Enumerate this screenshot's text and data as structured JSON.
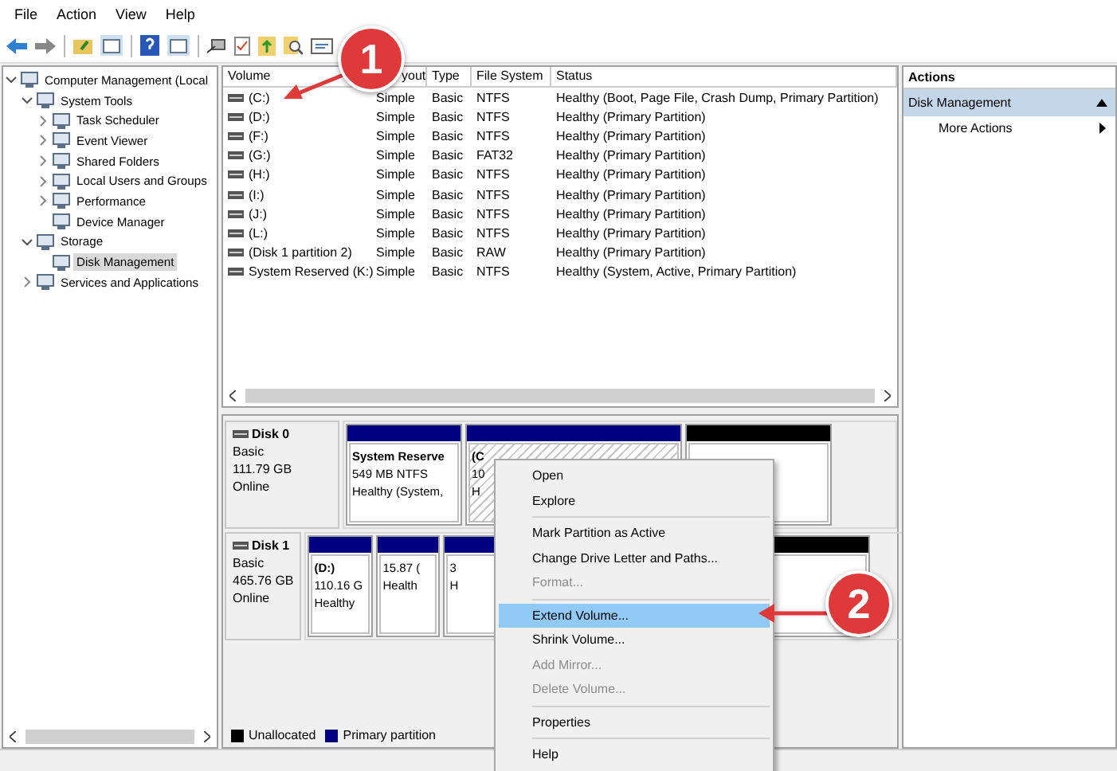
{
  "menu": [
    "File",
    "Action",
    "View",
    "Help"
  ],
  "tree": [
    {
      "label": "Computer Management (Local",
      "expanded": true,
      "selected": false,
      "children": [
        {
          "label": "System Tools",
          "expanded": true,
          "selected": false,
          "children": [
            {
              "label": "Task Scheduler",
              "expanded": false,
              "selected": false
            },
            {
              "label": "Event Viewer",
              "expanded": false,
              "selected": false
            },
            {
              "label": "Shared Folders",
              "expanded": false,
              "selected": false
            },
            {
              "label": "Local Users and Groups",
              "expanded": false,
              "selected": false
            },
            {
              "label": "Performance",
              "expanded": false,
              "selected": false
            },
            {
              "label": "Device Manager",
              "selected": false
            }
          ]
        },
        {
          "label": "Storage",
          "expanded": true,
          "selected": false,
          "children": [
            {
              "label": "Disk Management",
              "selected": true
            }
          ]
        },
        {
          "label": "Services and Applications",
          "expanded": false,
          "selected": false
        }
      ]
    }
  ],
  "volumes": {
    "columns": [
      "Volume",
      "yout",
      "Type",
      "File System",
      "Status"
    ],
    "rows": [
      [
        "(C:)",
        "Simple",
        "Basic",
        "NTFS",
        "Healthy (Boot, Page File, Crash Dump, Primary Partition)"
      ],
      [
        "(D:)",
        "Simple",
        "Basic",
        "NTFS",
        "Healthy (Primary Partition)"
      ],
      [
        "(F:)",
        "Simple",
        "Basic",
        "NTFS",
        "Healthy (Primary Partition)"
      ],
      [
        "(G:)",
        "Simple",
        "Basic",
        "FAT32",
        "Healthy (Primary Partition)"
      ],
      [
        "(H:)",
        "Simple",
        "Basic",
        "NTFS",
        "Healthy (Primary Partition)"
      ],
      [
        "(I:)",
        "Simple",
        "Basic",
        "NTFS",
        "Healthy (Primary Partition)"
      ],
      [
        "(J:)",
        "Simple",
        "Basic",
        "NTFS",
        "Healthy (Primary Partition)"
      ],
      [
        "(L:)",
        "Simple",
        "Basic",
        "NTFS",
        "Healthy (Primary Partition)"
      ],
      [
        "(Disk 1 partition 2)",
        "Simple",
        "Basic",
        "RAW",
        "Healthy (Primary Partition)"
      ],
      [
        "System Reserved (K:)",
        "Simple",
        "Basic",
        "NTFS",
        "Healthy (System, Active, Primary Partition)"
      ]
    ]
  },
  "disks": [
    {
      "name": "Disk 0",
      "lines": [
        "Basic",
        "111.79 GB",
        "Online"
      ],
      "partitions": [
        {
          "kind": "primary",
          "selected": false,
          "title": "System Reserve",
          "lines": [
            "549 MB NTFS",
            "Healthy (System,"
          ]
        },
        {
          "kind": "primary",
          "selected": true,
          "title": "(C",
          "lines": [
            "10",
            "H"
          ]
        },
        {
          "kind": "unallocated",
          "selected": false
        }
      ]
    },
    {
      "name": "Disk 1",
      "lines": [
        "Basic",
        "465.76 GB",
        "Online"
      ],
      "partitions": [
        {
          "kind": "primary",
          "selected": false,
          "title": "(D:)",
          "lines": [
            "110.16 G",
            "Healthy"
          ]
        },
        {
          "kind": "primary",
          "selected": false,
          "lines": [
            "15.87 (",
            "Health"
          ]
        },
        {
          "kind": "primary",
          "selected": false,
          "lines": [
            "3",
            "H"
          ]
        },
        {
          "kind": "unallocated",
          "selected": false
        }
      ]
    }
  ],
  "legend": [
    {
      "label": "Unallocated",
      "color": "#000000"
    },
    {
      "label": "Primary partition",
      "color": "#000080"
    }
  ],
  "actions": {
    "title": "Actions",
    "section": "Disk Management",
    "items": [
      "More Actions"
    ]
  },
  "context_menu": [
    {
      "label": "Open",
      "disabled": false,
      "selected": false
    },
    {
      "label": "Explore",
      "disabled": false,
      "selected": false,
      "separator_after": true
    },
    {
      "label": "Mark Partition as Active",
      "disabled": false,
      "selected": false
    },
    {
      "label": "Change Drive Letter and Paths...",
      "disabled": false,
      "selected": false
    },
    {
      "label": "Format...",
      "disabled": true,
      "selected": false,
      "separator_after": true
    },
    {
      "label": "Extend Volume...",
      "disabled": false,
      "selected": true
    },
    {
      "label": "Shrink Volume...",
      "disabled": false,
      "selected": false
    },
    {
      "label": "Add Mirror...",
      "disabled": true,
      "selected": false
    },
    {
      "label": "Delete Volume...",
      "disabled": true,
      "selected": false,
      "separator_after": true
    },
    {
      "label": "Properties",
      "disabled": false,
      "selected": false,
      "separator_after": true
    },
    {
      "label": "Help",
      "disabled": false,
      "selected": false
    }
  ],
  "callouts": [
    "1",
    "2"
  ]
}
